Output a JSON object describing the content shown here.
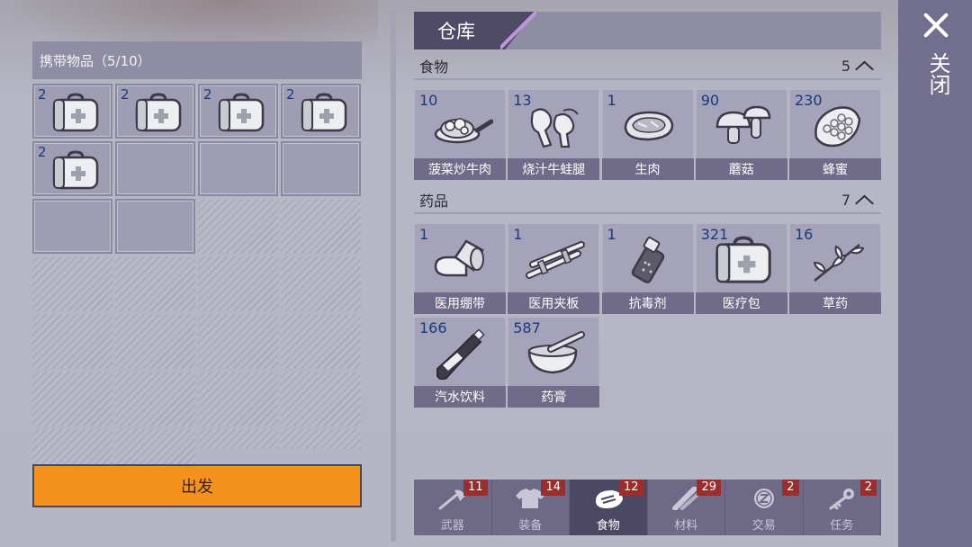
{
  "carry": {
    "title": "携带物品（5/10）",
    "items": [
      {
        "count": "2",
        "icon": "medkit"
      },
      {
        "count": "2",
        "icon": "medkit"
      },
      {
        "count": "2",
        "icon": "medkit"
      },
      {
        "count": "2",
        "icon": "medkit"
      },
      {
        "count": "2",
        "icon": "medkit"
      }
    ],
    "go_label": "出发"
  },
  "warehouse": {
    "title": "仓库",
    "food": {
      "label": "食物",
      "count": "5",
      "items": [
        {
          "count": "10",
          "label": "菠菜炒牛肉",
          "icon": "pan-icon"
        },
        {
          "count": "13",
          "label": "烧汁牛蛙腿",
          "icon": "frog-legs-icon"
        },
        {
          "count": "1",
          "label": "生肉",
          "icon": "steak-icon"
        },
        {
          "count": "90",
          "label": "蘑菇",
          "icon": "mushroom-icon"
        },
        {
          "count": "230",
          "label": "蜂蜜",
          "icon": "honeycomb-icon"
        }
      ]
    },
    "medicine": {
      "label": "药品",
      "count": "7",
      "items": [
        {
          "count": "1",
          "label": "医用绷带",
          "icon": "bandage-icon"
        },
        {
          "count": "1",
          "label": "医用夹板",
          "icon": "splint-icon"
        },
        {
          "count": "1",
          "label": "抗毒剂",
          "icon": "antidote-icon"
        },
        {
          "count": "321",
          "label": "医疗包",
          "icon": "medkit-icon"
        },
        {
          "count": "16",
          "label": "草药",
          "icon": "herb-icon"
        },
        {
          "count": "166",
          "label": "汽水饮料",
          "icon": "soda-icon"
        },
        {
          "count": "587",
          "label": "药膏",
          "icon": "ointment-icon"
        }
      ]
    }
  },
  "tabs": [
    {
      "label": "武器",
      "badge": "11",
      "icon": "axe-icon"
    },
    {
      "label": "装备",
      "badge": "14",
      "icon": "shirt-icon"
    },
    {
      "label": "食物",
      "badge": "12",
      "icon": "meat-icon",
      "active": true
    },
    {
      "label": "材料",
      "badge": "29",
      "icon": "material-icon"
    },
    {
      "label": "交易",
      "badge": "2",
      "icon": "coin-icon"
    },
    {
      "label": "任务",
      "badge": "2",
      "icon": "key-icon"
    }
  ],
  "close_label": "关闭",
  "colors": {
    "go_button": "#f5921d",
    "badge": "#9c2d2d",
    "count_text": "#1a3a7a"
  }
}
